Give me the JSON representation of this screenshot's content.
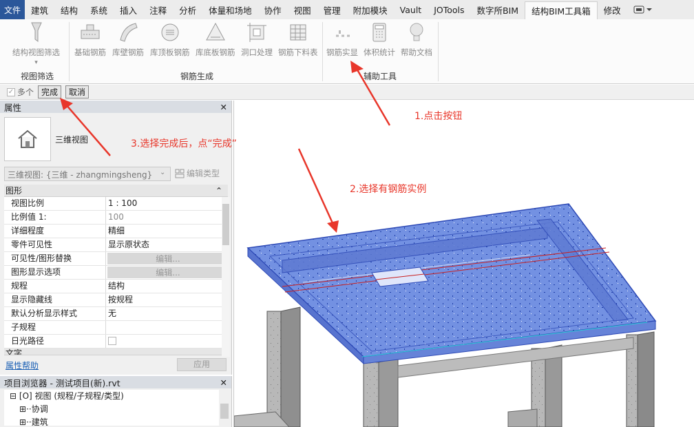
{
  "menu": {
    "file": "文件",
    "tabs": [
      "建筑",
      "结构",
      "系统",
      "插入",
      "注释",
      "分析",
      "体量和场地",
      "协作",
      "视图",
      "管理",
      "附加模块",
      "Vault",
      "JOTools",
      "数字所BIM",
      "结构BIM工具箱",
      "修改"
    ],
    "active_index": 14
  },
  "ribbon": {
    "buttons": [
      {
        "label": "结构视图筛选",
        "icon": "filter-icon"
      },
      {
        "label": "基础钢筋",
        "icon": "foundation-rebar-icon"
      },
      {
        "label": "库壁钢筋",
        "icon": "wall-rebar-icon"
      },
      {
        "label": "库顶板钢筋",
        "icon": "top-slab-rebar-icon"
      },
      {
        "label": "库底板钢筋",
        "icon": "bottom-slab-rebar-icon"
      },
      {
        "label": "洞口处理",
        "icon": "opening-icon"
      },
      {
        "label": "钢筋下料表",
        "icon": "schedule-icon"
      },
      {
        "label": "钢筋实显",
        "icon": "rebar-solid-icon"
      },
      {
        "label": "体积统计",
        "icon": "calculator-icon"
      },
      {
        "label": "帮助文档",
        "icon": "lightbulb-icon"
      }
    ],
    "panels": [
      "视图筛选",
      "钢筋生成",
      "辅助工具"
    ]
  },
  "options": {
    "multi": "多个",
    "finish": "完成",
    "cancel": "取消"
  },
  "properties": {
    "title": "属性",
    "type_name": "三维视图",
    "selector": "三维视图: {三维 - zhangmingsheng}",
    "edit_type": "编辑类型",
    "section": "图形",
    "rows": [
      [
        "视图比例",
        "1 : 100"
      ],
      [
        "比例值 1:",
        "100"
      ],
      [
        "详细程度",
        "精细"
      ],
      [
        "零件可见性",
        "显示原状态"
      ],
      [
        "可见性/图形替换",
        "编辑..."
      ],
      [
        "图形显示选项",
        "编辑..."
      ],
      [
        "规程",
        "结构"
      ],
      [
        "显示隐藏线",
        "按规程"
      ],
      [
        "默认分析显示样式",
        "无"
      ],
      [
        "子规程",
        ""
      ],
      [
        "日光路径",
        ""
      ]
    ],
    "next_section": "文字",
    "help": "属性帮助",
    "apply": "应用"
  },
  "browser": {
    "title": "项目浏览器 - 测试项目(新).rvt",
    "items": [
      "视图 (规程/子规程/类型)",
      "协调",
      "建筑"
    ]
  },
  "annotations": {
    "a1": "1.点击按钮",
    "a2": "2.选择有钢筋实例",
    "a3": "3.选择完成后，点“完成”"
  },
  "colors": {
    "arrow": "#e8362a",
    "slab": "#6f8fe0",
    "accent": "#2b579a"
  }
}
